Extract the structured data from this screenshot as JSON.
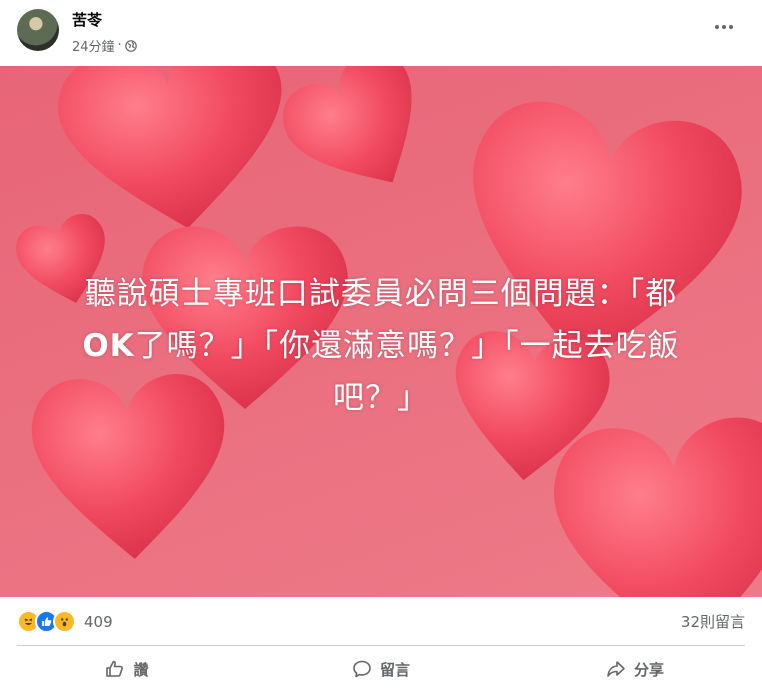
{
  "post": {
    "author": "苦苓",
    "timestamp": "24分鐘",
    "separator": "·",
    "privacy_icon": "globe-icon",
    "more_icon": "more-options-icon",
    "image_text_line1": "聽說碩士專班口試委員必問三個問題：「都",
    "image_text_line2_bold": "OK",
    "image_text_line2_rest": "了嗎？」「你還滿意嗎？」「一起去吃飯",
    "image_text_line3": "吧？」"
  },
  "stats": {
    "reaction_icons": [
      "haha-reaction-icon",
      "like-reaction-icon",
      "wow-reaction-icon"
    ],
    "reaction_count": "409",
    "comment_count": "32則留言"
  },
  "actions": {
    "like_label": "讚",
    "comment_label": "留言",
    "share_label": "分享"
  },
  "colors": {
    "background_pink": "#ea6f7f",
    "heart_red": "#f04a5f",
    "meta_gray": "#65676b"
  }
}
